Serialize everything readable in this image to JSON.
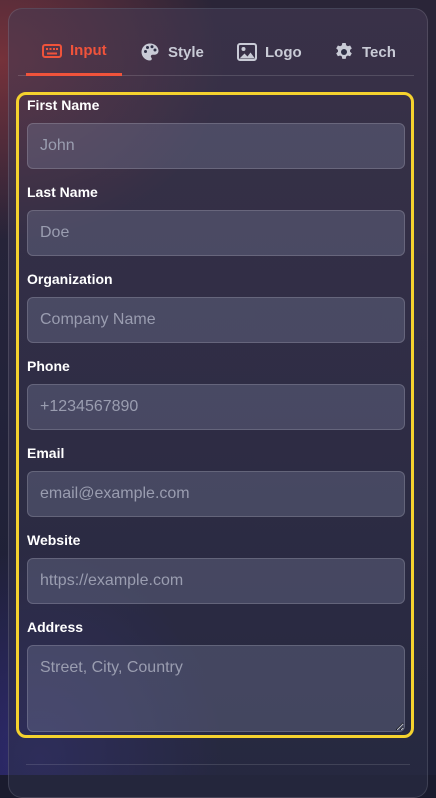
{
  "tabs": [
    {
      "label": "Input",
      "icon": "keyboard-icon",
      "active": true
    },
    {
      "label": "Style",
      "icon": "palette-icon",
      "active": false
    },
    {
      "label": "Logo",
      "icon": "image-icon",
      "active": false
    },
    {
      "label": "Tech",
      "icon": "gear-icon",
      "active": false
    }
  ],
  "fields": {
    "first_name": {
      "label": "First Name",
      "value": "",
      "placeholder": "John"
    },
    "last_name": {
      "label": "Last Name",
      "value": "",
      "placeholder": "Doe"
    },
    "organization": {
      "label": "Organization",
      "value": "",
      "placeholder": "Company Name"
    },
    "phone": {
      "label": "Phone",
      "value": "",
      "placeholder": "+1234567890"
    },
    "email": {
      "label": "Email",
      "value": "",
      "placeholder": "email@example.com"
    },
    "website": {
      "label": "Website",
      "value": "",
      "placeholder": "https://example.com"
    },
    "address": {
      "label": "Address",
      "value": "",
      "placeholder": "Street, City, Country"
    }
  },
  "colors": {
    "accent": "#f0533b",
    "highlight": "#f5d22e",
    "tab_text": "#c9cbd6"
  }
}
